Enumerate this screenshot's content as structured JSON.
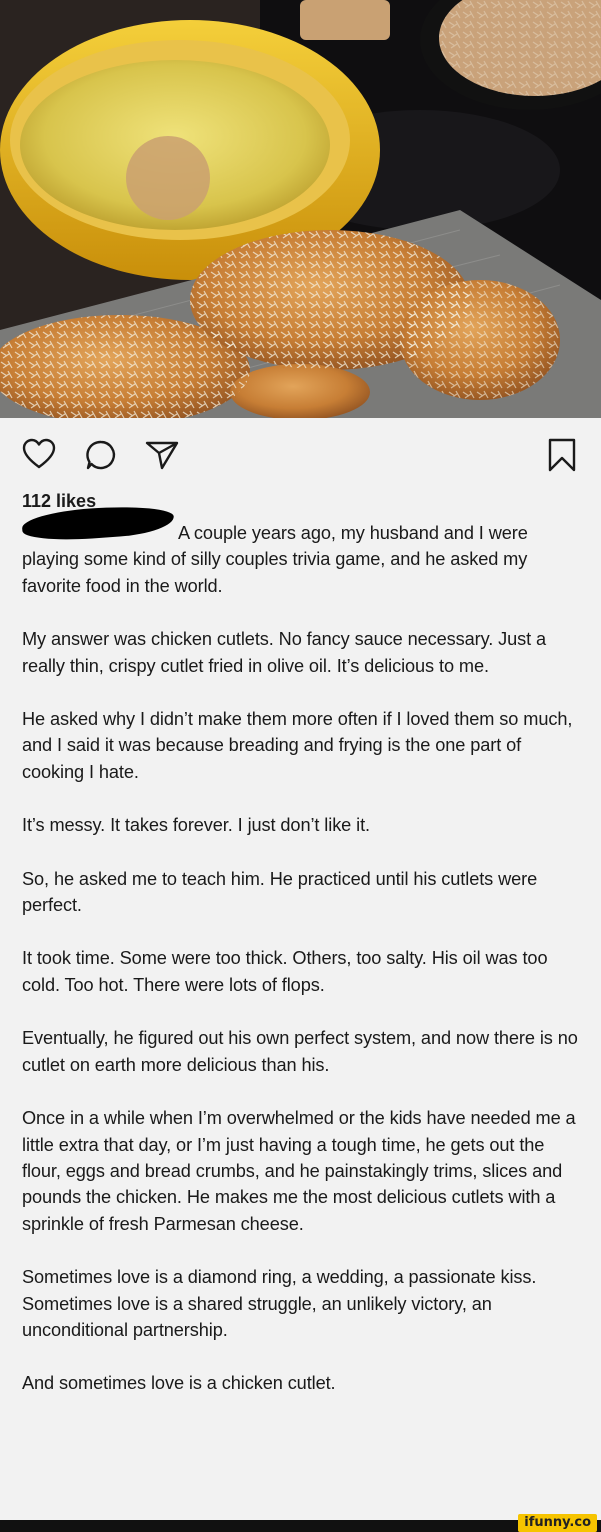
{
  "post": {
    "likes_text": "112 likes",
    "username": "",
    "caption_first_line": "A couple years ago, my husband and I were playing some kind of silly couples trivia game, and he asked my favorite food in the world.",
    "paragraphs": [
      "My answer was chicken cutlets. No fancy sauce necessary. Just a really thin, crispy cutlet fried in olive oil. It’s delicious to me.",
      "He asked why I didn’t make them more often if I loved them so much, and I said it was because breading and frying is the one part of cooking I hate.",
      "It’s messy. It takes forever. I just don’t like it.",
      "So, he asked me to teach him. He practiced until his cutlets were perfect.",
      "It took time. Some were too thick. Others, too salty. His oil was too cold. Too hot. There were lots of flops.",
      "Eventually, he figured out his own perfect system, and now there is no cutlet on earth more delicious than his.",
      "Once in a while when I’m overwhelmed or the kids have needed me a little extra that day, or I’m just having a tough time, he gets out the flour, eggs and bread crumbs, and he painstakingly trims, slices and pounds the chicken. He makes me the most delicious cutlets with a sprinkle of fresh Parmesan cheese.",
      "Sometimes love is a diamond ring, a wedding, a passionate kiss. Sometimes love is a shared struggle, an unlikely victory, an unconditional partnership.",
      "And sometimes love is a chicken cutlet."
    ]
  },
  "icons": {
    "like": "heart-icon",
    "comment": "comment-icon",
    "share": "send-icon",
    "save": "bookmark-icon"
  },
  "watermark": "ifunny.co",
  "colors": {
    "background": "#f2f2f2",
    "text": "#1a1a1a",
    "pot": "#e8b81c",
    "oil": "#d9c24a",
    "watermark_bg": "#f6c400"
  }
}
